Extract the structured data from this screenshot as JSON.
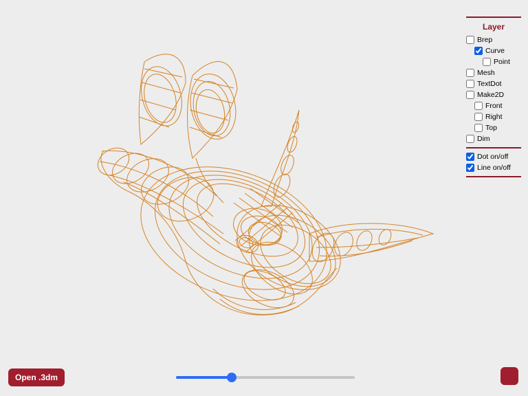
{
  "panel": {
    "title": "Layer",
    "items": [
      {
        "label": "Brep",
        "checked": false,
        "indent": 0
      },
      {
        "label": "Curve",
        "checked": true,
        "indent": 1
      },
      {
        "label": "Point",
        "checked": false,
        "indent": 2
      },
      {
        "label": "Mesh",
        "checked": false,
        "indent": 0
      },
      {
        "label": "TextDot",
        "checked": false,
        "indent": 0
      },
      {
        "label": "Make2D",
        "checked": false,
        "indent": 0
      },
      {
        "label": "Front",
        "checked": false,
        "indent": 1
      },
      {
        "label": "Right",
        "checked": false,
        "indent": 1
      },
      {
        "label": "Top",
        "checked": false,
        "indent": 1
      },
      {
        "label": "Dim",
        "checked": false,
        "indent": 0
      }
    ],
    "toggles": [
      {
        "label": "Dot on/off",
        "checked": true
      },
      {
        "label": "Line on/off",
        "checked": true
      }
    ]
  },
  "open_button": {
    "label": "Open .3dm"
  },
  "slider": {
    "min": 0,
    "max": 100,
    "value": 30
  },
  "colors": {
    "wire": "#d58427",
    "accent": "#a01e2e",
    "slider_active": "#2e6cf6"
  }
}
